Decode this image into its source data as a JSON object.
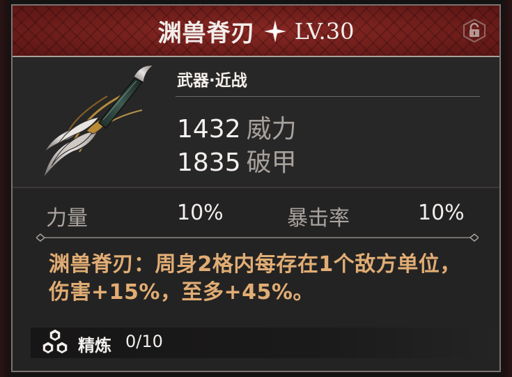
{
  "header": {
    "weapon_name": "渊兽脊刃",
    "level": "LV.30",
    "star_icon": "four-point-star-icon",
    "lock_icon": "padlock-icon"
  },
  "info": {
    "category": "武器·近战",
    "stats": [
      {
        "value": "1432",
        "label": "威力"
      },
      {
        "value": "1835",
        "label": "破甲"
      }
    ]
  },
  "attributes": [
    {
      "label": "力量",
      "value": "10%"
    },
    {
      "label": "暴击率",
      "value": "10%"
    }
  ],
  "effect": {
    "text": "渊兽脊刃：周身2格内每存在1个敌方单位，伤害+15%，至多+45%。"
  },
  "refine": {
    "label": "精炼",
    "value": "0/10",
    "icon": "refine-hex-icon"
  },
  "colors": {
    "header_bg": "#6e1f1c",
    "effect_text": "#e1ad74",
    "stat_label": "#a7a29d"
  }
}
